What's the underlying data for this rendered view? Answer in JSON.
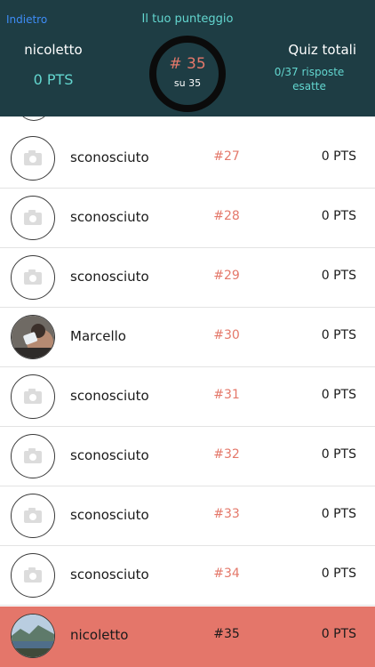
{
  "header": {
    "back_label": "Indietro",
    "title": "Il tuo punteggio",
    "user_name": "nicoletto",
    "user_points": "0 PTS",
    "rank_label": "# 35",
    "rank_total_label": "su 35",
    "quiz_title": "Quiz totali",
    "quiz_subtitle": "0/37 risposte esatte"
  },
  "leaderboard": {
    "rows": [
      {
        "name": "sconosciuto",
        "rank": "#27",
        "points": "0 PTS",
        "avatar": "camera-placeholder-icon"
      },
      {
        "name": "sconosciuto",
        "rank": "#28",
        "points": "0 PTS",
        "avatar": "camera-placeholder-icon"
      },
      {
        "name": "sconosciuto",
        "rank": "#29",
        "points": "0 PTS",
        "avatar": "camera-placeholder-icon"
      },
      {
        "name": "Marcello",
        "rank": "#30",
        "points": "0 PTS",
        "avatar": "user-photo"
      },
      {
        "name": "sconosciuto",
        "rank": "#31",
        "points": "0 PTS",
        "avatar": "camera-placeholder-icon"
      },
      {
        "name": "sconosciuto",
        "rank": "#32",
        "points": "0 PTS",
        "avatar": "camera-placeholder-icon"
      },
      {
        "name": "sconosciuto",
        "rank": "#33",
        "points": "0 PTS",
        "avatar": "camera-placeholder-icon"
      },
      {
        "name": "sconosciuto",
        "rank": "#34",
        "points": "0 PTS",
        "avatar": "camera-placeholder-icon"
      },
      {
        "name": "nicoletto",
        "rank": "#35",
        "points": "0 PTS",
        "avatar": "landscape-photo",
        "current_user": true
      }
    ]
  },
  "colors": {
    "header_bg": "#1e3d44",
    "accent_teal": "#63d6cf",
    "accent_coral": "#e4786a",
    "current_row_bg": "#e4766a",
    "back_link": "#3e8cf6"
  }
}
